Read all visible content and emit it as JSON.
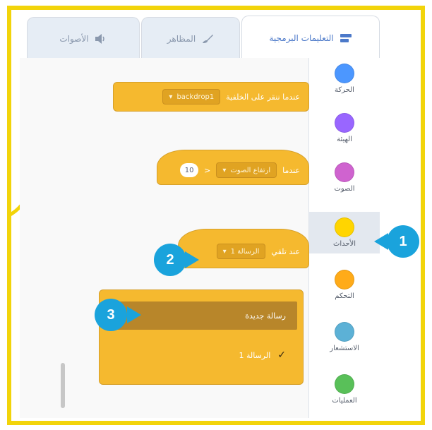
{
  "tabs": [
    {
      "label": "التعليمات البرمجية",
      "icon": "code-blocks-icon",
      "active": true
    },
    {
      "label": "المظاهر",
      "icon": "paintbrush-icon",
      "active": false
    },
    {
      "label": "الأصوات",
      "icon": "speaker-icon",
      "active": false
    }
  ],
  "categories": [
    {
      "label": "الحركة",
      "color": "#4c97ff"
    },
    {
      "label": "الهيئة",
      "color": "#9966ff"
    },
    {
      "label": "الصوت",
      "color": "#cf63cf"
    },
    {
      "label": "الأحداث",
      "color": "#ffd500"
    },
    {
      "label": "التحكم",
      "color": "#ffab19"
    },
    {
      "label": "الاستشعار",
      "color": "#5cb1d6"
    },
    {
      "label": "العمليات",
      "color": "#59c059"
    }
  ],
  "blocks": {
    "top": {
      "text": "عندما ننقر على الخلفية",
      "dropdown": "backdrop1"
    },
    "middle": {
      "text": "عندما",
      "dropdown": "ارتفاع الصوت",
      "op": ">",
      "number": "10"
    },
    "hat": {
      "text": "عند تلقي",
      "dropdown": "الرسالة 1"
    }
  },
  "dropdown_menu": {
    "items": [
      {
        "label": "رسالة جديدة",
        "checked": false
      },
      {
        "label": "الرسالة 1",
        "checked": true
      }
    ]
  },
  "callouts": {
    "one": "1",
    "two": "2",
    "three": "3"
  },
  "colors": {
    "frame": "#f2d40a",
    "callout": "#1aa3dc",
    "events": "#ffbf00"
  }
}
